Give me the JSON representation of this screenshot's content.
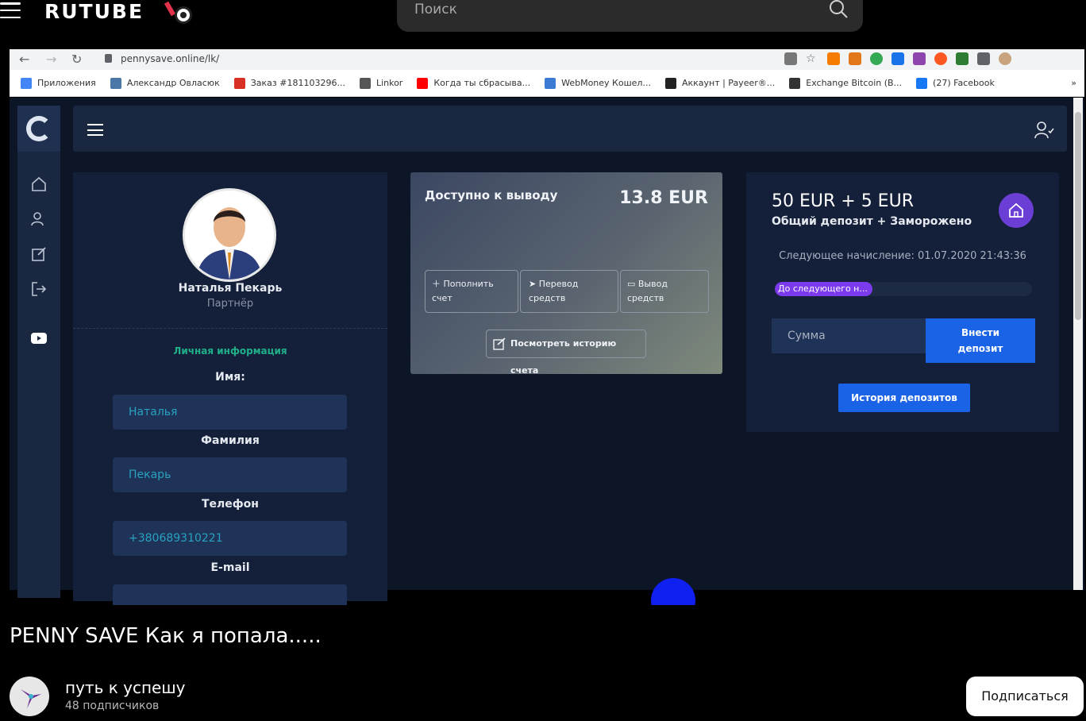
{
  "header": {
    "logo": "RUTUBE",
    "search_placeholder": "Поиск"
  },
  "browser": {
    "url": "pennysave.online/lk/",
    "bookmarks": [
      {
        "label": "Приложения",
        "color": "#4285f4"
      },
      {
        "label": "Александр Овласюк",
        "color": "#4a76a8"
      },
      {
        "label": "Заказ #181103296...",
        "color": "#d93025"
      },
      {
        "label": "Linkor",
        "color": "#555555"
      },
      {
        "label": "Когда ты сбрасыва...",
        "color": "#ff0000"
      },
      {
        "label": "WebMoney Кошел...",
        "color": "#3b7bd4"
      },
      {
        "label": "Аккаунт | Payeer®...",
        "color": "#222222"
      },
      {
        "label": "Exchange Bitcoin (B...",
        "color": "#333333"
      },
      {
        "label": "(27) Facebook",
        "color": "#1877f2"
      }
    ],
    "more_bookmarks": "»"
  },
  "profile": {
    "name": "Наталья Пекарь",
    "role": "Партнёр",
    "section_title": "Личная информация",
    "fields": [
      {
        "label": "Имя:",
        "value": "Наталья"
      },
      {
        "label": "Фамилия",
        "value": "Пекарь"
      },
      {
        "label": "Телефон",
        "value": "+380689310221"
      },
      {
        "label": "E-mail",
        "value": ""
      }
    ]
  },
  "withdraw": {
    "title": "Доступно к выводу",
    "amount": "13.8 EUR",
    "buttons": [
      {
        "line1": "Пополнить",
        "line2": "счет"
      },
      {
        "line1": "Перевод",
        "line2": "средств"
      },
      {
        "line1": "Вывод",
        "line2": "средств"
      }
    ],
    "history_label": "Посмотреть историю счета"
  },
  "deposit": {
    "title": "50 EUR + 5 EUR",
    "subtitle": "Общий депозит + Заморожено",
    "next_accrual": "Следующее начисление: 01.07.2020 21:43:36",
    "progress_label": "До следующего н...",
    "progress_fraction": 0.38,
    "amount_placeholder": "Сумма",
    "submit_line1": "Внести",
    "submit_line2": "депозит",
    "history_label": "История депозитов"
  },
  "video": {
    "title": "PENNY SAVE Как я попала.....",
    "channel_name": "путь к успешу",
    "subscribers": "48 подписчиков",
    "subscribe_label": "Подписаться"
  }
}
